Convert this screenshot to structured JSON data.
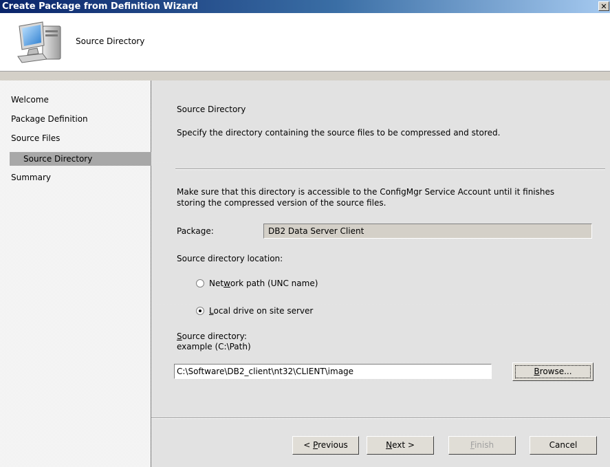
{
  "window": {
    "title": "Create Package from Definition Wizard",
    "close_glyph": "✕"
  },
  "header": {
    "title": "Source Directory",
    "icon": "computer-icon"
  },
  "sidebar": {
    "items": [
      {
        "label": "Welcome"
      },
      {
        "label": "Package Definition"
      },
      {
        "label": "Source Files"
      },
      {
        "label": "Source Directory",
        "selected": true
      },
      {
        "label": "Summary"
      }
    ]
  },
  "main": {
    "heading": "Source Directory",
    "description": "Specify the directory containing the source files to be compressed and stored.",
    "note_line1": "Make sure that this directory is accessible to the ConfigMgr Service Account until it finishes",
    "note_line2": "storing the compressed version of the source files.",
    "package_label": "Package:",
    "package_value": "DB2 Data Server Client",
    "location_label": "Source directory location:",
    "radio_network": {
      "pre": "Net",
      "accel": "w",
      "post": "ork path (UNC name)",
      "checked": false
    },
    "radio_local": {
      "pre": "",
      "accel": "L",
      "post": "ocal drive on site server",
      "checked": true
    },
    "source_dir_label": {
      "accel": "S",
      "post": "ource directory:"
    },
    "example_label": "example (C:\\Path)",
    "source_dir_value": "C:\\Software\\DB2_client\\nt32\\CLIENT\\image",
    "browse": {
      "accel": "B",
      "post": "rowse..."
    }
  },
  "buttons": {
    "previous": {
      "pre": "< ",
      "accel": "P",
      "post": "revious"
    },
    "next": {
      "accel": "N",
      "post": "ext >"
    },
    "finish": {
      "accel": "F",
      "post": "inish",
      "disabled": true
    },
    "cancel": "Cancel"
  }
}
